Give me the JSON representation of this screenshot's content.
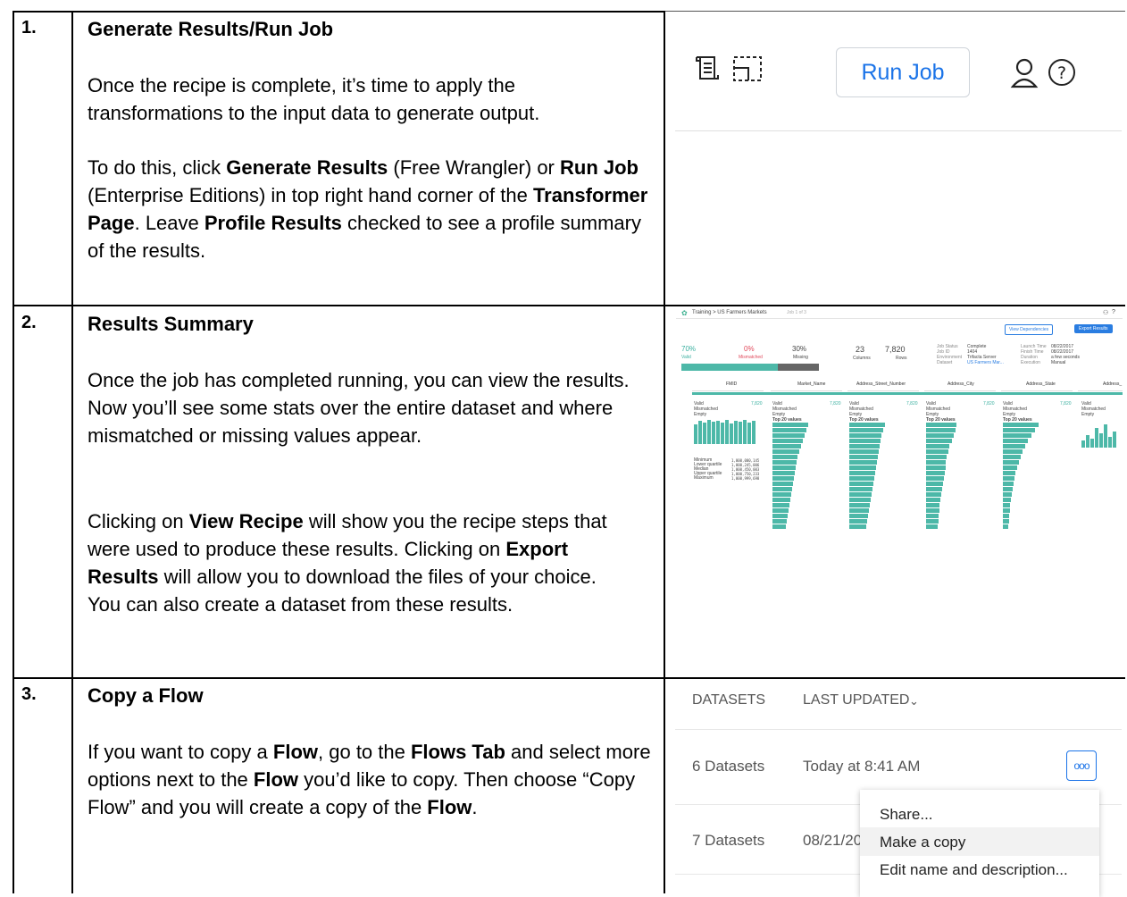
{
  "rows": [
    {
      "number": "1.",
      "title": "Generate Results/Run Job",
      "para1": "Once the recipe is complete, it’s time to apply the transformations to the input data to generate output.",
      "para2_parts": [
        "To do this, click ",
        "Generate Results",
        " (Free Wrangler) or ",
        "Run Job",
        " (Enterprise Editions) in top right hand corner of the ",
        "Transformer Page",
        ". Leave ",
        "Profile Results",
        " checked to see a profile summary of the results."
      ]
    },
    {
      "number": "2.",
      "title": "Results Summary",
      "para1": "Once the job has completed running, you can view the results.  Now you’ll see some stats over the entire dataset and where mismatched or missing values appear.",
      "para2_parts": [
        "Clicking on ",
        "View Recipe",
        " will show you the recipe steps that were used to produce these results. Clicking on ",
        "Export Results",
        " will allow you to download the files of your choice.  You can also create a dataset from these results."
      ]
    },
    {
      "number": "3.",
      "title": "Copy a Flow",
      "para1_parts": [
        "If you want to copy a ",
        "Flow",
        ", go to the ",
        "Flows Tab",
        " and select more options next to the ",
        "Flow",
        " you’d like to copy. Then choose “Copy Flow” and you will create a copy of the ",
        "Flow",
        "."
      ]
    }
  ],
  "panel1": {
    "run_job_label": "Run Job",
    "icons": [
      "recipe-icon",
      "layout-icon",
      "user-icon",
      "help-icon"
    ]
  },
  "panel2": {
    "breadcrumb": "Training > US Farmers Markets",
    "job_label": "Job 1 of 3",
    "view_dependencies": "View Dependencies",
    "export_results": "Export Results",
    "valid_pct": "70%",
    "valid_label": "Valid",
    "mismatched_pct": "0%",
    "mismatched_label": "Mismatched",
    "missing_pct": "30%",
    "missing_label": "Missing",
    "columns_value": "23",
    "columns_label": "Columns",
    "rows_value": "7,820",
    "rows_label": "Rows",
    "job_info_labels": [
      "Job Status",
      "Job ID",
      "Environment",
      "Dataset"
    ],
    "job_info_values": [
      "Complete",
      "1404",
      "Trifacta Server",
      "US Farmers Mar..."
    ],
    "time_labels": [
      "Launch Time",
      "Finish Time",
      "Duration",
      "Execution"
    ],
    "time_values": [
      "08/22/2017",
      "08/22/2017",
      "a few seconds",
      "Manual"
    ],
    "column_headers": [
      "FMID",
      "Market_Name",
      "Address_Street_Number",
      "Address_City",
      "Address_State",
      "Address_"
    ],
    "stat_labels": [
      "Valid",
      "Mismatched",
      "Empty"
    ],
    "stat_value": "7,820",
    "top_values_label": "Top 20 values",
    "fmid_stats": [
      "Minimum",
      "Lower quartile",
      "Median",
      "Upper quartile",
      "Maximum"
    ],
    "fmid_stat_values": [
      "1,000,000,145",
      "1,000,245,006",
      "1,000,450,003",
      "1,000,750,233",
      "1,000,999,698"
    ]
  },
  "panel3": {
    "col_datasets": "DATASETS",
    "col_last_updated": "LAST UPDATED",
    "row1_datasets": "6 Datasets",
    "row1_updated": "Today at 8:41 AM",
    "row2_datasets": "7 Datasets",
    "row2_updated": "08/21/20",
    "more_label": "ooo",
    "menu_items": [
      "Share...",
      "Make a copy",
      "Edit name and description..."
    ]
  }
}
